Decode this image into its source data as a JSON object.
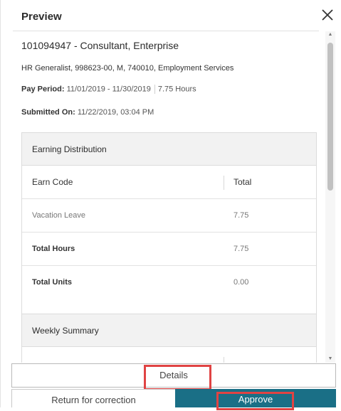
{
  "dialog": {
    "title": "Preview",
    "close_icon": "close-icon"
  },
  "job": {
    "heading": "101094947 - Consultant, Enterprise",
    "subheading": "HR Generalist, 998623-00, M, 740010, Employment Services",
    "pay_period_label": "Pay Period:",
    "pay_period_value": "11/01/2019 - 11/30/2019",
    "hours": "7.75 Hours",
    "submitted_label": "Submitted On:",
    "submitted_value": "11/22/2019, 03:04 PM"
  },
  "earning_distribution": {
    "title": "Earning Distribution",
    "columns": [
      "Earn Code",
      "Total"
    ],
    "rows": [
      {
        "code": "Vacation Leave",
        "total": "7.75"
      }
    ],
    "totals": [
      {
        "label": "Total Hours",
        "value": "7.75"
      },
      {
        "label": "Total Units",
        "value": "0.00"
      }
    ]
  },
  "weekly_summary": {
    "title": "Weekly Summary"
  },
  "actions": {
    "details": "Details",
    "return": "Return for correction",
    "approve": "Approve"
  },
  "colors": {
    "approve_bg": "#1a6f86",
    "highlight": "#e04343"
  }
}
